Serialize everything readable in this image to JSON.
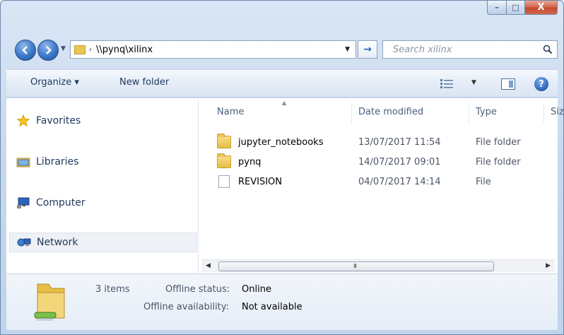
{
  "window": {
    "caption": {
      "minimize": "–",
      "maximize": "□",
      "close": "X"
    }
  },
  "address": {
    "path": "\\\\pynq\\xilinx",
    "go": "→"
  },
  "search": {
    "placeholder": "Search xilinx"
  },
  "toolbar": {
    "organize": "Organize ▾",
    "new_folder": "New folder",
    "help": "?"
  },
  "nav": {
    "items": [
      {
        "label": "Favorites",
        "icon": "star-icon"
      },
      {
        "label": "Libraries",
        "icon": "libraries-icon"
      },
      {
        "label": "Computer",
        "icon": "computer-icon"
      },
      {
        "label": "Network",
        "icon": "network-icon"
      }
    ]
  },
  "columns": {
    "name": "Name",
    "date": "Date modified",
    "type": "Type",
    "size": "Siz"
  },
  "files": [
    {
      "name": "jupyter_notebooks",
      "date": "13/07/2017 11:54",
      "type": "File folder",
      "icon": "folder-icon"
    },
    {
      "name": "pynq",
      "date": "14/07/2017 09:01",
      "type": "File folder",
      "icon": "folder-icon"
    },
    {
      "name": "REVISION",
      "date": "04/07/2017 14:14",
      "type": "File",
      "icon": "file-icon"
    }
  ],
  "scrollbar": {
    "grip": "III"
  },
  "details": {
    "count": "3 items",
    "offline_status_label": "Offline status:",
    "offline_status_value": "Online",
    "offline_availability_label": "Offline availability:",
    "offline_availability_value": "Not available"
  },
  "colors": {
    "accent": "#2a62b8",
    "close": "#c44a2f",
    "folder": "#e8bd44"
  }
}
